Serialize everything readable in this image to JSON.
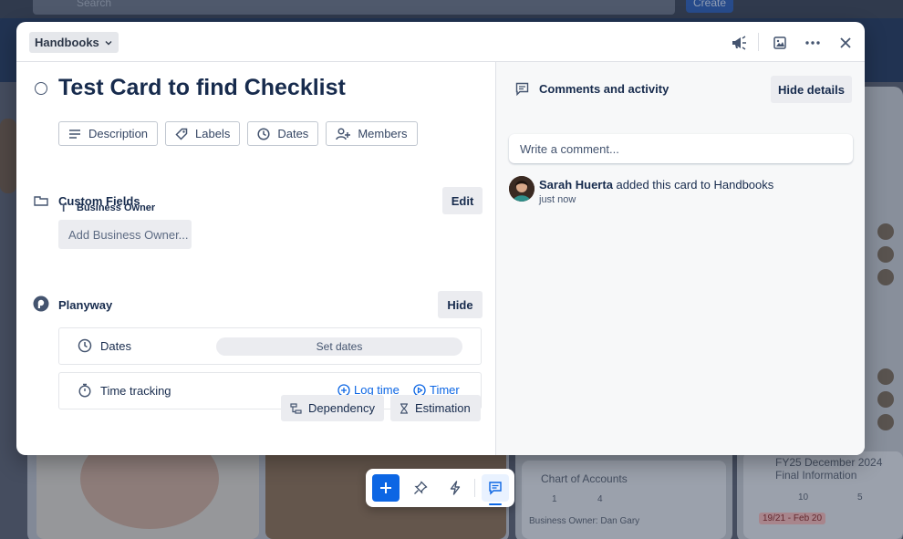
{
  "background": {
    "search_placeholder": "Search",
    "create_label": "Create",
    "cards": [
      {
        "title": "Chart of Accounts",
        "comments": "1",
        "attachments": "4",
        "owner": "Business Owner: Dan Gary"
      },
      {
        "title": "FY25 December 2024 Final Information",
        "comments": "10",
        "attachments": "5",
        "date": "19/21 - Feb 20"
      }
    ]
  },
  "header": {
    "list_name": "Handbooks",
    "icons": [
      "megaphone-icon",
      "image-icon",
      "more-icon",
      "close-icon"
    ]
  },
  "card": {
    "title": "Test Card to find Checklist",
    "chips": [
      {
        "label": "Description",
        "icon": "description-icon"
      },
      {
        "label": "Labels",
        "icon": "tag-icon"
      },
      {
        "label": "Dates",
        "icon": "clock-icon"
      },
      {
        "label": "Members",
        "icon": "add-member-icon"
      }
    ],
    "custom_fields": {
      "title": "Custom Fields",
      "edit_label": "Edit",
      "field_label": "Business Owner",
      "field_placeholder": "Add Business Owner..."
    },
    "planyway": {
      "title": "Planyway",
      "hide_label": "Hide",
      "dates_label": "Dates",
      "set_dates_label": "Set dates",
      "time_tracking_label": "Time tracking",
      "log_time_label": "Log time",
      "timer_label": "Timer",
      "dependency_label": "Dependency",
      "estimation_label": "Estimation"
    }
  },
  "activity": {
    "title": "Comments and activity",
    "hide_details_label": "Hide details",
    "comment_placeholder": "Write a comment...",
    "entries": [
      {
        "user": "Sarah Huerta",
        "action": " added this card to Handbooks",
        "time": "just now"
      }
    ]
  },
  "colors": {
    "accent": "#0c66e4",
    "board": "#243a5e"
  }
}
